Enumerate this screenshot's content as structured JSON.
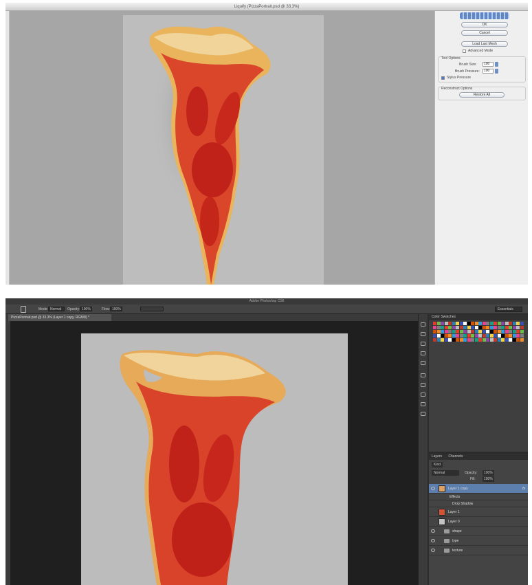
{
  "liquify": {
    "title": "Liquify (PizzaPortrait.psd @ 33.3%)",
    "buttons": {
      "ok": "OK",
      "cancel": "Cancel",
      "load_last_mesh": "Load Last Mesh",
      "restore_all": "Restore All"
    },
    "advanced_mode_label": "Advanced Mode",
    "tool_options_title": "Tool Options",
    "brush_size_label": "Brush Size:",
    "brush_size_value": "100",
    "brush_pressure_label": "Brush Pressure:",
    "brush_pressure_value": "100",
    "stylus_pressure_label": "Stylus Pressure",
    "reconstruct_title": "Reconstruct Options"
  },
  "photoshop": {
    "app_title": "Adobe Photoshop CS6",
    "workspace": "Essentials",
    "options": {
      "mode_label": "Mode:",
      "mode_value": "Normal",
      "opacity_label": "Opacity:",
      "opacity_value": "100%",
      "flow_label": "Flow:",
      "flow_value": "100%"
    },
    "doc_tab": "PizzaPortrait.psd @ 33.3% (Layer 1 copy, RGB/8) *",
    "swatches_tabs": "Color  Swatches",
    "layers": {
      "tabs": [
        "Layers",
        "Channels"
      ],
      "kind_label": "Kind",
      "blend_mode": "Normal",
      "opacity_label": "Opacity:",
      "opacity_value": "100%",
      "fill_label": "Fill:",
      "fill_value": "100%",
      "items": [
        {
          "name": "Layer 1 copy",
          "fx": "fx",
          "selected": true
        },
        {
          "name": "Effects"
        },
        {
          "name": "Drop Shadow"
        },
        {
          "name": "Layer 1"
        },
        {
          "name": "Layer 0"
        },
        {
          "name": "shape"
        },
        {
          "name": "type"
        },
        {
          "name": "texture"
        }
      ]
    }
  }
}
